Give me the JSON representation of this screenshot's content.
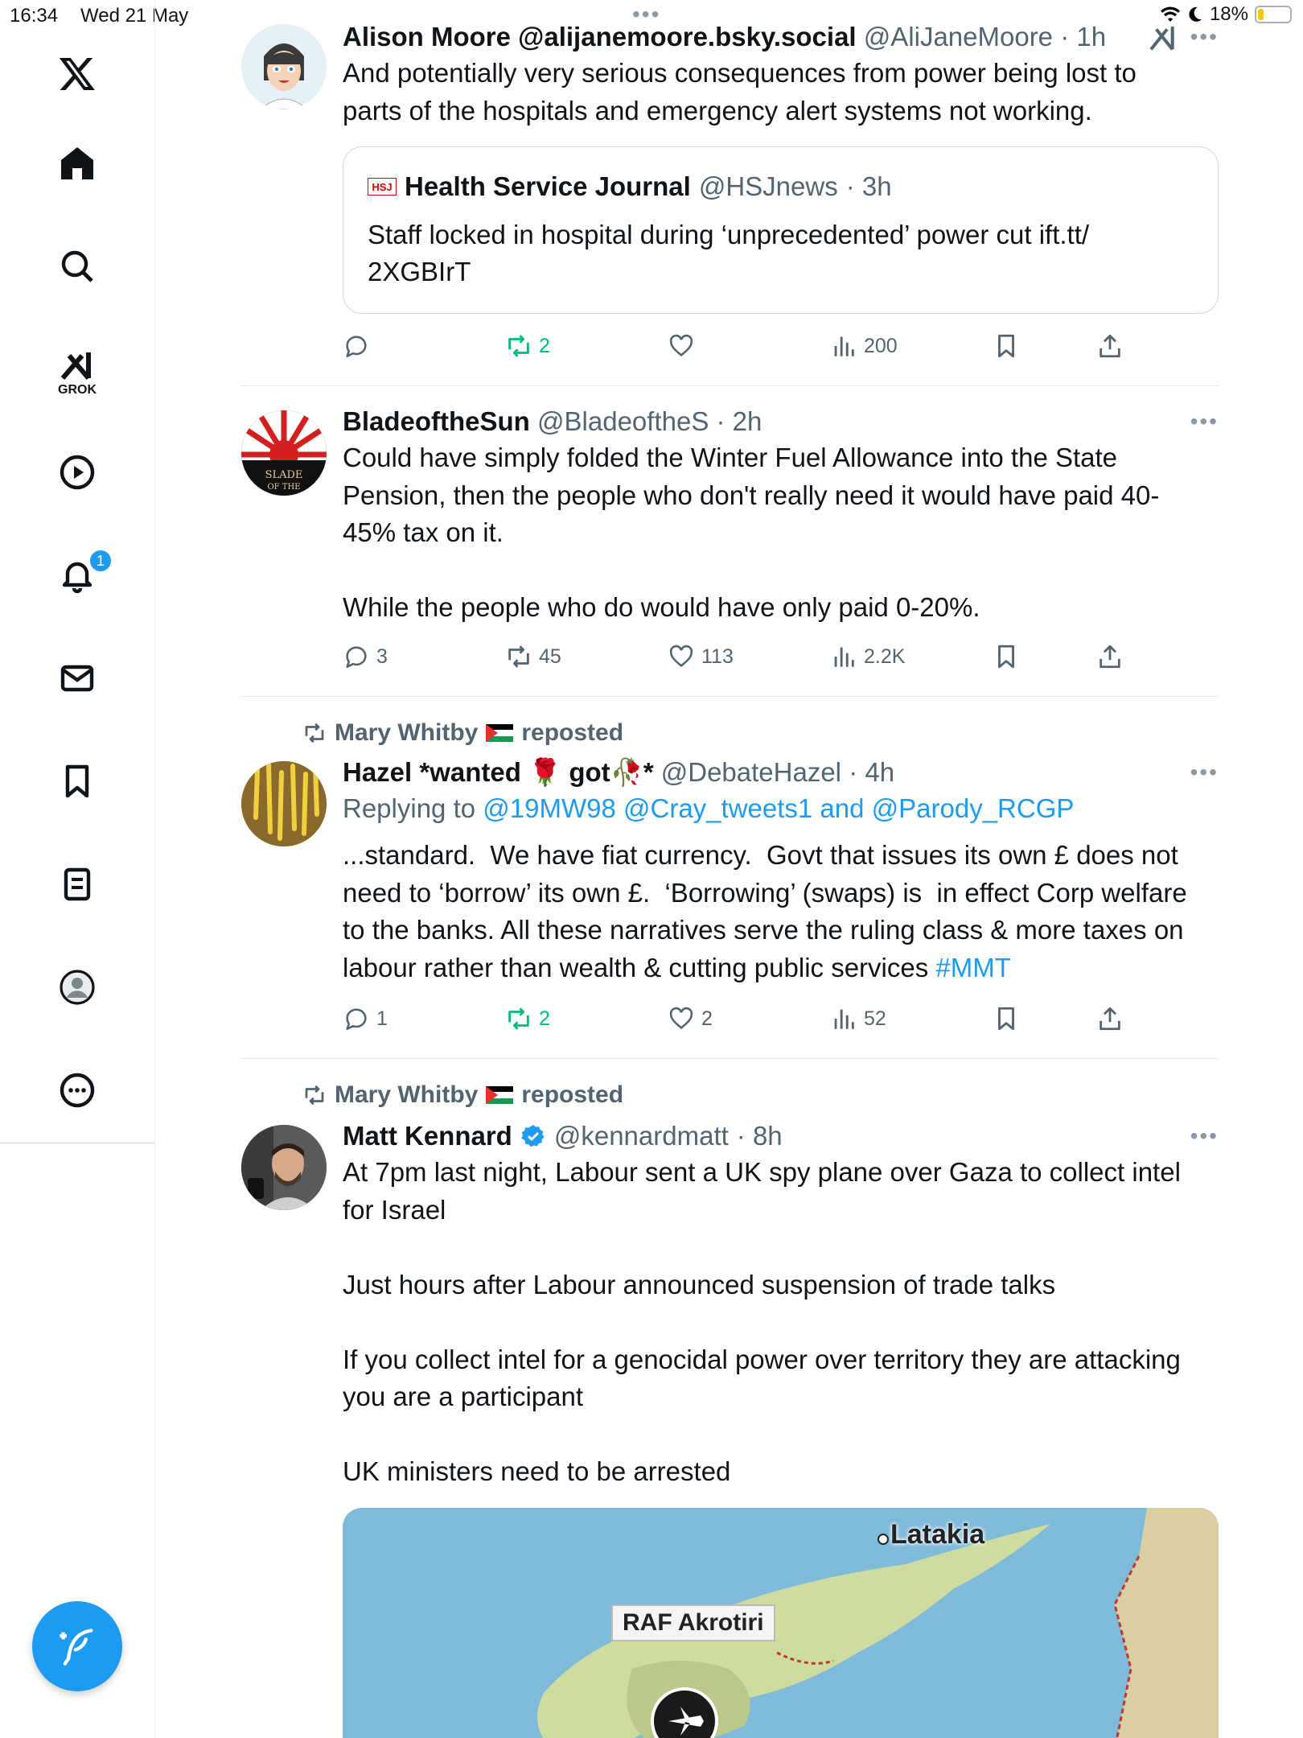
{
  "status": {
    "time": "16:34",
    "date": "Wed 21 May",
    "battery": "18%",
    "battery_level": 0.18
  },
  "sidebar": {
    "logo": "x-logo-icon",
    "items": [
      {
        "name": "home",
        "icon": "home-icon"
      },
      {
        "name": "search",
        "icon": "search-icon"
      },
      {
        "name": "grok",
        "icon": "grok-icon",
        "label": "GROK"
      },
      {
        "name": "videos",
        "icon": "play-icon"
      },
      {
        "name": "notifications",
        "icon": "bell-icon",
        "badge": "1"
      },
      {
        "name": "messages",
        "icon": "mail-icon"
      },
      {
        "name": "bookmarks",
        "icon": "bookmark-icon"
      },
      {
        "name": "lists",
        "icon": "list-icon"
      },
      {
        "name": "profile",
        "icon": "profile-icon"
      },
      {
        "name": "more",
        "icon": "more-icon"
      }
    ],
    "compose_icon": "compose-icon"
  },
  "tweets": [
    {
      "name": "Alison Moore @alijanemoore.bsky.social",
      "handle": "@AliJaneMoore",
      "time": "· 1h",
      "text": "And potentially very serious consequences from power being lost to parts of the hospitals and emergency alert systems not working.",
      "quote": {
        "logo": "HSJ",
        "name": "Health Service Journal",
        "handle": "@HSJnews",
        "time": "· 3h",
        "text": "Staff locked in hospital during ‘unprecedented’ power cut ift.tt/ 2XGBIrT"
      },
      "stats": {
        "replies": "",
        "reposts": "2",
        "likes": "",
        "views": "200"
      }
    },
    {
      "name": "BladeoftheSun",
      "handle": "@BladeoftheS",
      "time": "· 2h",
      "text": "Could have simply folded the Winter Fuel Allowance into the State Pension, then the people who don't really need it would have paid 40-45% tax on it.\n\nWhile the people who do would have only paid 0-20%.",
      "stats": {
        "replies": "3",
        "reposts": "45",
        "likes": "113",
        "views": "2.2K"
      }
    },
    {
      "repost_by": "Mary Whitby",
      "repost_label": "reposted",
      "name": "Hazel *wanted 🌹 got🥀*",
      "handle": "@DebateHazel",
      "time": "· 4h",
      "reply_prefix": "Replying to",
      "reply_to": "@19MW98 @Cray_tweets1 and @Parody_RCGP",
      "text": "...standard.  We have fiat currency.  Govt that issues its own £ does not need to ‘borrow’ its own £.  ‘Borrowing’ (swaps) is  in effect Corp welfare to the banks. All these narratives serve the ruling class & more taxes on labour rather than wealth & cutting public services ",
      "hashtag": "#MMT",
      "stats": {
        "replies": "1",
        "reposts": "2",
        "likes": "2",
        "views": "52"
      }
    },
    {
      "repost_by": "Mary Whitby",
      "repost_label": "reposted",
      "name": "Matt Kennard",
      "handle": "@kennardmatt",
      "time": "· 8h",
      "text": "At 7pm last night, Labour sent a UK spy plane over Gaza to collect intel for Israel\n\nJust hours after Labour announced suspension of trade talks\n\nIf you collect intel for a genocidal power over territory they are attacking you are a participant\n\nUK ministers need to be arrested",
      "media": {
        "label_base": "RAF Akrotiri",
        "label_city": "Latakia"
      }
    }
  ],
  "colors": {
    "accent": "#1d9bf0",
    "repost_green": "#00ba7c",
    "muted": "#536471"
  }
}
